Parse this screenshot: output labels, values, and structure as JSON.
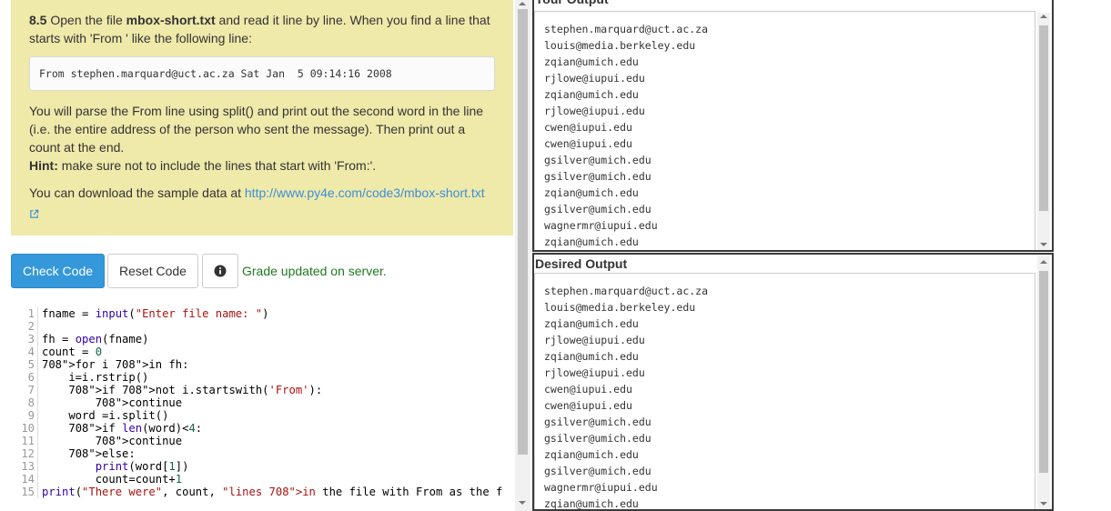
{
  "question": {
    "number": "8.5",
    "intro_pre": " Open the file ",
    "filename": "mbox-short.txt",
    "intro_post": " and read it line by line. When you find a line that starts with 'From ' like the following line:",
    "sample_line": "From stephen.marquard@uct.ac.za Sat Jan  5 09:14:16 2008",
    "para2": "You will parse the From line using split() and print out the second word in the line (i.e. the entire address of the person who sent the message). Then print out a count at the end.",
    "hint_label": "Hint:",
    "hint_text": " make sure not to include the lines that start with 'From:'.",
    "download_text": "You can download the sample data at ",
    "download_link": "http://www.py4e.com/code3/mbox-short.txt"
  },
  "toolbar": {
    "check_label": "Check Code",
    "reset_label": "Reset Code",
    "grade_message": "Grade updated on server."
  },
  "code_lines": [
    "fname = input(\"Enter file name: \")",
    "",
    "fh = open(fname)",
    "count = 0",
    "for i in fh:",
    "    i=i.rstrip()",
    "    if not i.startswith('From'):",
    "        continue",
    "    word =i.split()",
    "    if len(word)<4:",
    "        continue",
    "    else:",
    "        print(word[1])",
    "        count=count+1",
    "print(\"There were\", count, \"lines in the file with From as the f"
  ],
  "your_output": {
    "title": "Your Output",
    "lines": [
      "stephen.marquard@uct.ac.za",
      "louis@media.berkeley.edu",
      "zqian@umich.edu",
      "rjlowe@iupui.edu",
      "zqian@umich.edu",
      "rjlowe@iupui.edu",
      "cwen@iupui.edu",
      "cwen@iupui.edu",
      "gsilver@umich.edu",
      "gsilver@umich.edu",
      "zqian@umich.edu",
      "gsilver@umich.edu",
      "wagnermr@iupui.edu",
      "zqian@umich.edu"
    ]
  },
  "desired_output": {
    "title": "Desired Output",
    "lines": [
      "stephen.marquard@uct.ac.za",
      "louis@media.berkeley.edu",
      "zqian@umich.edu",
      "rjlowe@iupui.edu",
      "zqian@umich.edu",
      "rjlowe@iupui.edu",
      "cwen@iupui.edu",
      "cwen@iupui.edu",
      "gsilver@umich.edu",
      "gsilver@umich.edu",
      "zqian@umich.edu",
      "gsilver@umich.edu",
      "wagnermr@iupui.edu",
      "zqian@umich.edu"
    ]
  },
  "colors": {
    "question_bg": "#efe9aa",
    "check_button": "#3498db",
    "grade_message": "#1f7a1f",
    "link": "#3a8fd8"
  }
}
